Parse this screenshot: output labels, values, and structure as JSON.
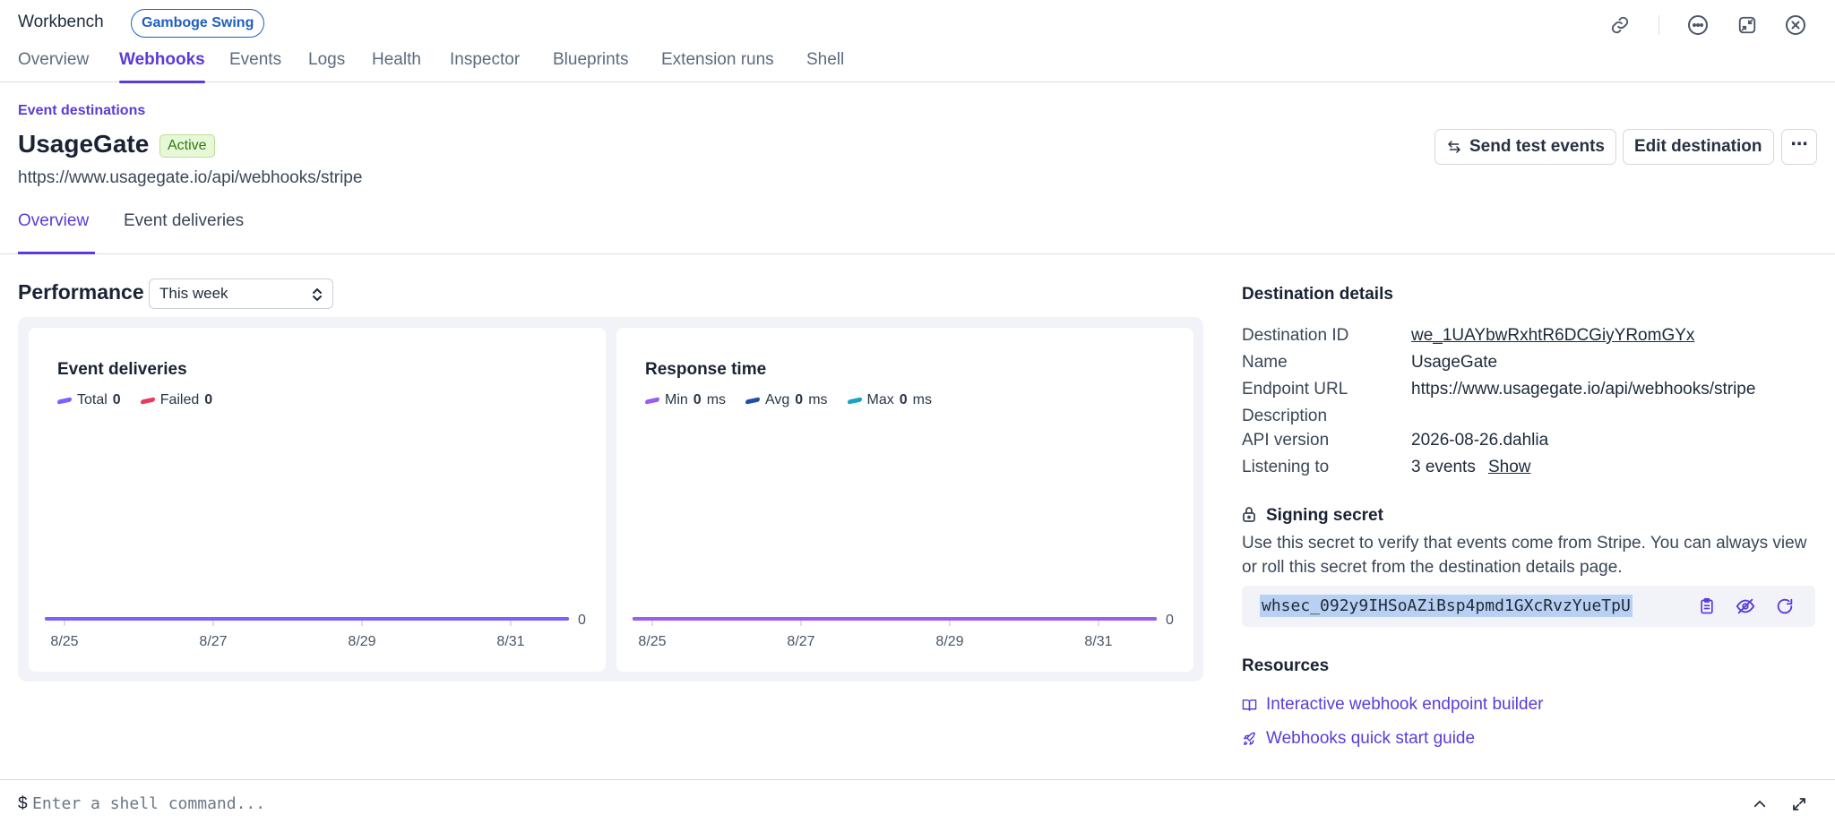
{
  "app": {
    "title": "Workbench",
    "account_badge": "Gamboge Swing"
  },
  "top_icons": [
    "link-icon",
    "more-icon",
    "minimize-icon",
    "close-icon"
  ],
  "main_nav": {
    "tabs": [
      "Overview",
      "Webhooks",
      "Events",
      "Logs",
      "Health",
      "Inspector",
      "Blueprints",
      "Extension runs",
      "Shell"
    ],
    "active": "Webhooks"
  },
  "destination": {
    "breadcrumb": "Event destinations",
    "name": "UsageGate",
    "status": "Active",
    "url": "https://www.usagegate.io/api/webhooks/stripe"
  },
  "actions": {
    "send_test": "Send test events",
    "edit": "Edit destination",
    "more": "⋯"
  },
  "sub_nav": {
    "tabs": [
      "Overview",
      "Event deliveries"
    ],
    "active": "Overview"
  },
  "performance": {
    "title": "Performance",
    "range": "This week"
  },
  "chart_data": [
    {
      "type": "line",
      "title": "Event deliveries",
      "categories": [
        "8/25",
        "8/27",
        "8/29",
        "8/31"
      ],
      "series": [
        {
          "name": "Total",
          "total": "0",
          "color": "#7b61ff",
          "values": [
            0,
            0,
            0,
            0
          ]
        },
        {
          "name": "Failed",
          "total": "0",
          "color": "#ea3a5b",
          "values": [
            0,
            0,
            0,
            0
          ]
        }
      ],
      "y_tick": "0"
    },
    {
      "type": "line",
      "title": "Response time",
      "categories": [
        "8/25",
        "8/27",
        "8/29",
        "8/31"
      ],
      "series": [
        {
          "name": "Min",
          "total": "0",
          "unit": "ms",
          "color": "#9b5cf0",
          "values": [
            0,
            0,
            0,
            0
          ]
        },
        {
          "name": "Avg",
          "total": "0",
          "unit": "ms",
          "color": "#1f4fa8",
          "values": [
            0,
            0,
            0,
            0
          ]
        },
        {
          "name": "Max",
          "total": "0",
          "unit": "ms",
          "color": "#1aa3c7",
          "values": [
            0,
            0,
            0,
            0
          ]
        }
      ],
      "y_tick": "0"
    }
  ],
  "details": {
    "heading": "Destination details",
    "rows": [
      {
        "label": "Destination ID",
        "value": "we_1UAYbwRxhtR6DCGiyYRomGYx"
      },
      {
        "label": "Name",
        "value": "UsageGate"
      },
      {
        "label": "Endpoint URL",
        "value": "https://www.usagegate.io/api/webhooks/stripe"
      },
      {
        "label": "Description",
        "value": ""
      },
      {
        "label": "API version",
        "value": "2026-08-26.dahlia"
      },
      {
        "label": "Listening to",
        "value": "3 events"
      }
    ],
    "show_link": "Show"
  },
  "signing_secret": {
    "heading": "Signing secret",
    "description": "Use this secret to verify that events come from Stripe. You can always view or roll this secret from the destination details page.",
    "value": "whsec_092y9IHSoAZiBsp4pmd1GXcRvzYueTpU"
  },
  "resources": {
    "heading": "Resources",
    "links": [
      "Interactive webhook endpoint builder",
      "Webhooks quick start guide"
    ]
  },
  "shell": {
    "prompt": "$",
    "placeholder": "Enter a shell command..."
  },
  "colors": {
    "accent": "#5b3bd9",
    "badge_blue": "#1f5fbf",
    "active_green": "#2d7a12"
  }
}
